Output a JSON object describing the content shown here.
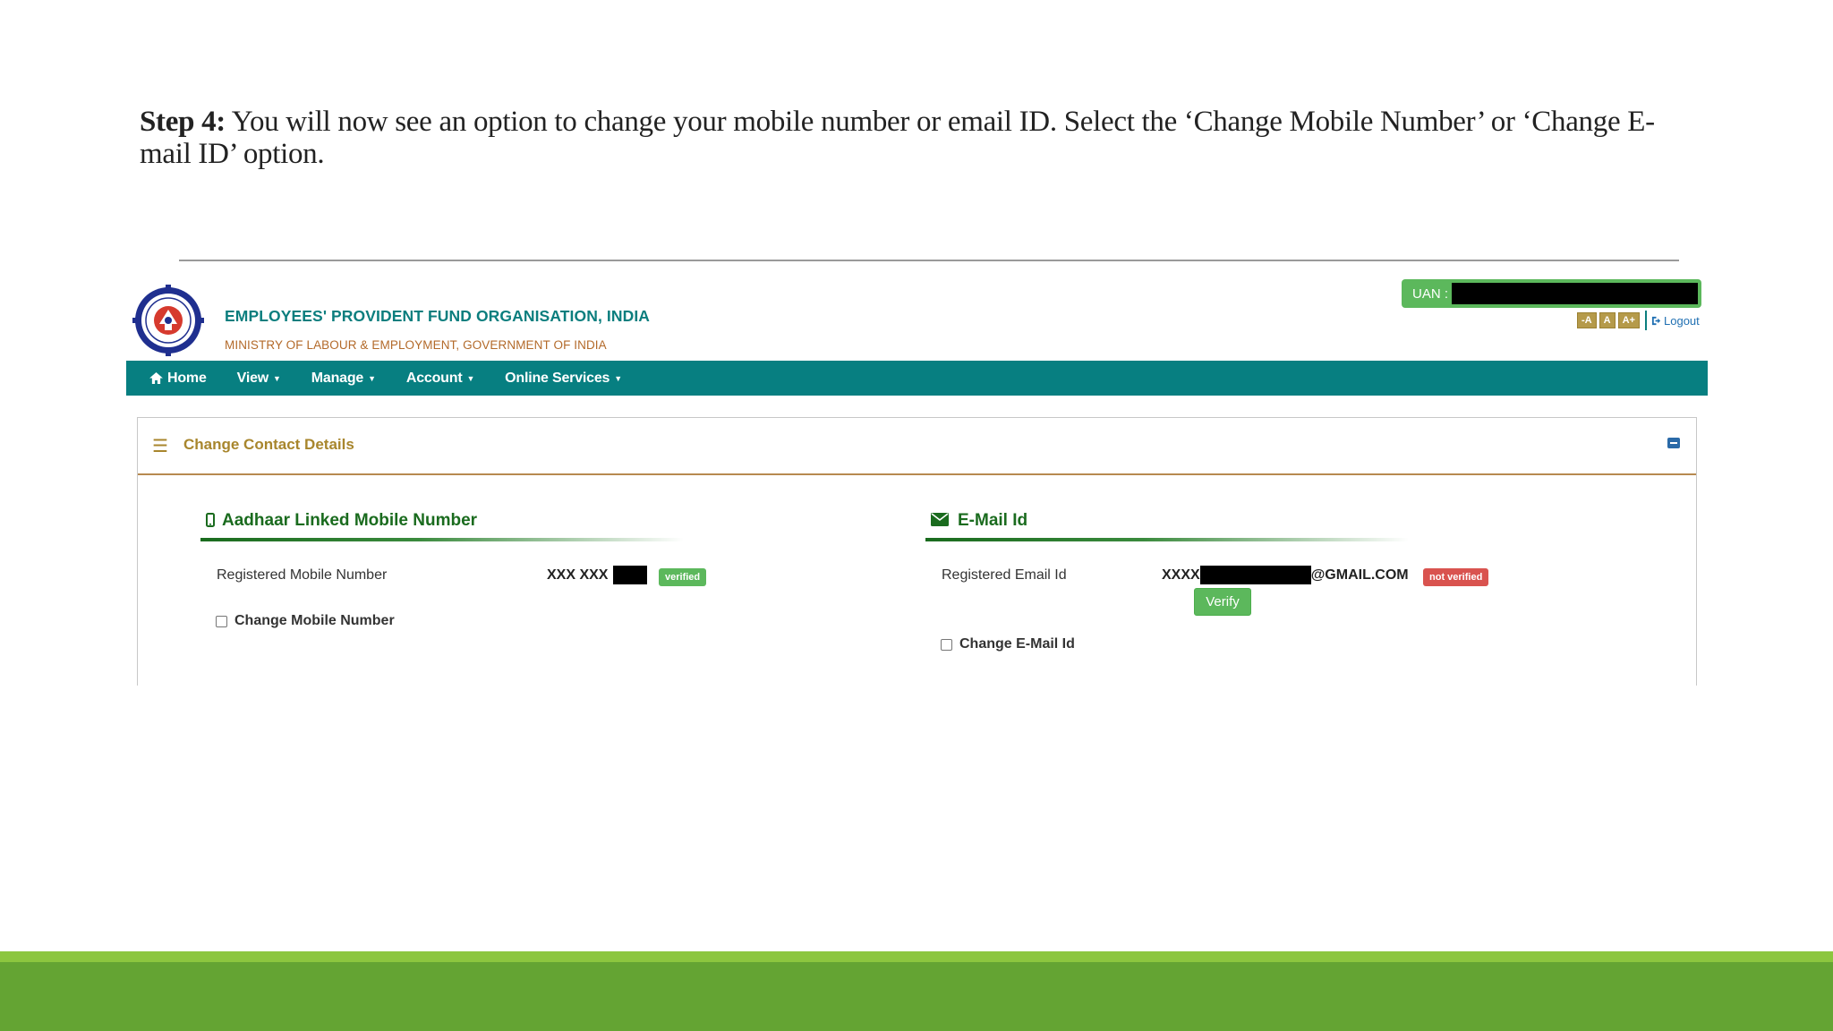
{
  "slide": {
    "step_label": "Step 4:",
    "step_text": " You will now see an option to change your mobile number or email ID. Select the ‘Change Mobile Number’ or ‘Change E-mail ID’ option."
  },
  "header": {
    "org_title": "EMPLOYEES' PROVIDENT FUND ORGANISATION, INDIA",
    "org_subtitle": "MINISTRY OF LABOUR & EMPLOYMENT, GOVERNMENT OF INDIA",
    "uan_label": "UAN :",
    "font_sizes": [
      "-A",
      "A",
      "A+"
    ],
    "logout_label": "Logout",
    "logout_icon": "sign-out-icon"
  },
  "nav": {
    "items": [
      {
        "label": "Home",
        "icon": "home-icon"
      },
      {
        "label": "View"
      },
      {
        "label": "Manage"
      },
      {
        "label": "Account"
      },
      {
        "label": "Online Services"
      }
    ]
  },
  "panel": {
    "title": "Change Contact Details",
    "mobile": {
      "heading": "Aadhaar Linked Mobile Number",
      "icon": "mobile-icon",
      "label": "Registered Mobile Number",
      "value_prefix": "XXX XXX",
      "badge": "verified",
      "checkbox_label": "Change Mobile Number"
    },
    "email": {
      "heading": "E-Mail Id",
      "icon": "envelope-icon",
      "label": "Registered Email Id",
      "value_prefix": "XXXX",
      "value_suffix": "@GMAIL.COM",
      "badge": "not verified",
      "verify_label": "Verify",
      "checkbox_label": "Change E-Mail Id"
    }
  },
  "colors": {
    "nav_bg": "#077f81",
    "org_title": "#0b7e7e",
    "panel_title": "#a8862d",
    "section_heading": "#1a6b1e",
    "success": "#5cb85c",
    "danger": "#d9534f",
    "footer_light": "#8cc63f",
    "footer_dark": "#64a433"
  }
}
